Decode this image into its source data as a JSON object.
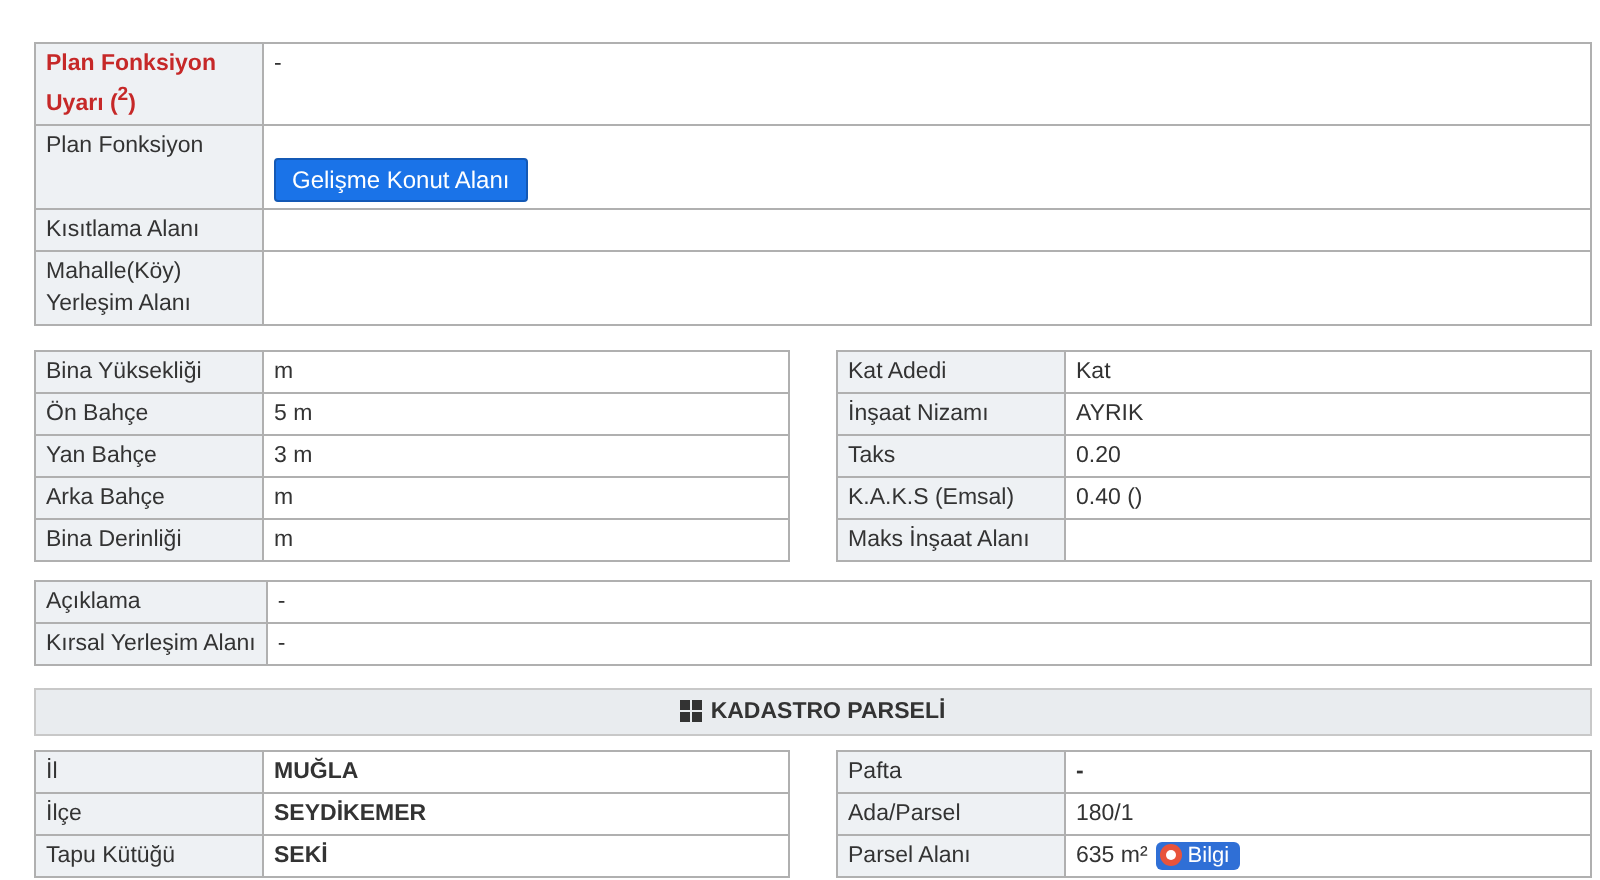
{
  "plan_table": {
    "rows": [
      {
        "label": "Plan Fonksiyon Uyarı ($^{2}$)",
        "warning": true,
        "kind": "text",
        "value": "-"
      },
      {
        "label": "Plan Fonksiyon",
        "warning": false,
        "kind": "button",
        "value": "Gelişme Konut Alanı"
      },
      {
        "label": "Kısıtlama Alanı",
        "warning": false,
        "kind": "text",
        "value": ""
      },
      {
        "label": "Mahalle(Köy) Yerleşim Alanı",
        "warning": false,
        "kind": "text",
        "value": ""
      }
    ]
  },
  "building_left": [
    {
      "label": "Bina Yüksekliği",
      "value": "m"
    },
    {
      "label": "Ön Bahçe",
      "value": "5 m"
    },
    {
      "label": "Yan Bahçe",
      "value": "3 m"
    },
    {
      "label": "Arka Bahçe",
      "value": "m"
    },
    {
      "label": "Bina Derinliği",
      "value": "m"
    }
  ],
  "building_right": [
    {
      "label": "Kat Adedi",
      "value": "Kat"
    },
    {
      "label": "İnşaat Nizamı",
      "value": "AYRIK"
    },
    {
      "label": "Taks",
      "value": "0.20"
    },
    {
      "label": "K.A.K.S (Emsal)",
      "value": "0.40 ()"
    },
    {
      "label": "Maks İnşaat Alanı"
    }
  ],
  "notes_table": [
    {
      "label": "Açıklama",
      "value": "-"
    },
    {
      "label": "Kırsal Yerleşim Alanı",
      "value": "-"
    }
  ],
  "cadastre": {
    "title": "KADASTRO PARSELİ",
    "left": [
      {
        "label": "İl",
        "value": "MUĞLA"
      },
      {
        "label": "İlçe",
        "value": "SEYDİKEMER"
      },
      {
        "label": "Tapu Kütüğü",
        "value": "SEKİ"
      }
    ],
    "right": [
      {
        "label": "Pafta",
        "value": "-"
      },
      {
        "label": "Ada/Parsel",
        "value": "180/1"
      },
      {
        "label": "Parsel Alanı",
        "value": "635 m²",
        "badge": "Bilgi"
      }
    ]
  }
}
